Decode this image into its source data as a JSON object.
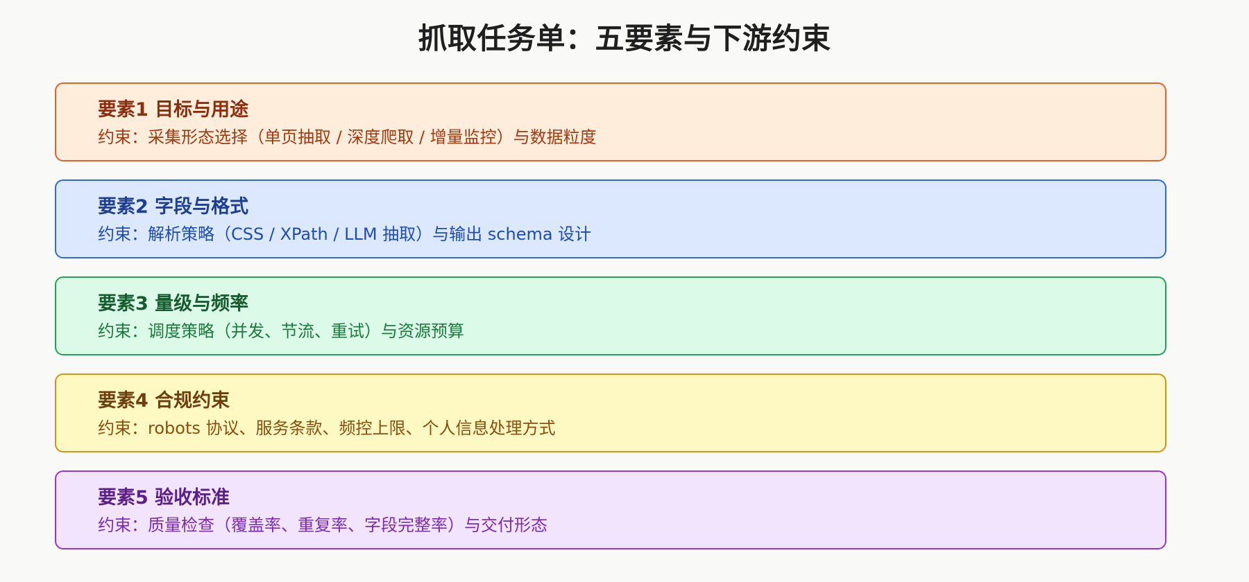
{
  "title": "抓取任务单：五要素与下游约束",
  "cards": [
    {
      "heading": "要素1 目标与用途",
      "constraint": "约束：采集形态选择（单页抽取 / 深度爬取 / 增量监控）与数据粒度",
      "colors": {
        "bg": "#feeddb",
        "border": "#e2622a",
        "heading": "#8b2e0e",
        "text": "#a33a12"
      }
    },
    {
      "heading": "要素2 字段与格式",
      "constraint": "约束：解析策略（CSS / XPath / LLM 抽取）与输出 schema 设计",
      "colors": {
        "bg": "#dbe8fe",
        "border": "#2e6ad8",
        "heading": "#1e3f8f",
        "text": "#1e4cb3"
      }
    },
    {
      "heading": "要素3 量级与频率",
      "constraint": "约束：调度策略（并发、节流、重试）与资源预算",
      "colors": {
        "bg": "#dbfbe8",
        "border": "#22a354",
        "heading": "#155c2f",
        "text": "#1d7a3e"
      }
    },
    {
      "heading": "要素4 合规约束",
      "constraint": "约束：robots 协议、服务条款、频控上限、个人信息处理方式",
      "colors": {
        "bg": "#fef8c3",
        "border": "#d39416",
        "heading": "#6e3f0c",
        "text": "#8a4f0d"
      }
    },
    {
      "heading": "要素5 验收标准",
      "constraint": "约束：质量检查（覆盖率、重复率、字段完整率）与交付形态",
      "colors": {
        "bg": "#f3e4fe",
        "border": "#9434dc",
        "heading": "#5b1f8a",
        "text": "#7a2cb3"
      }
    }
  ]
}
